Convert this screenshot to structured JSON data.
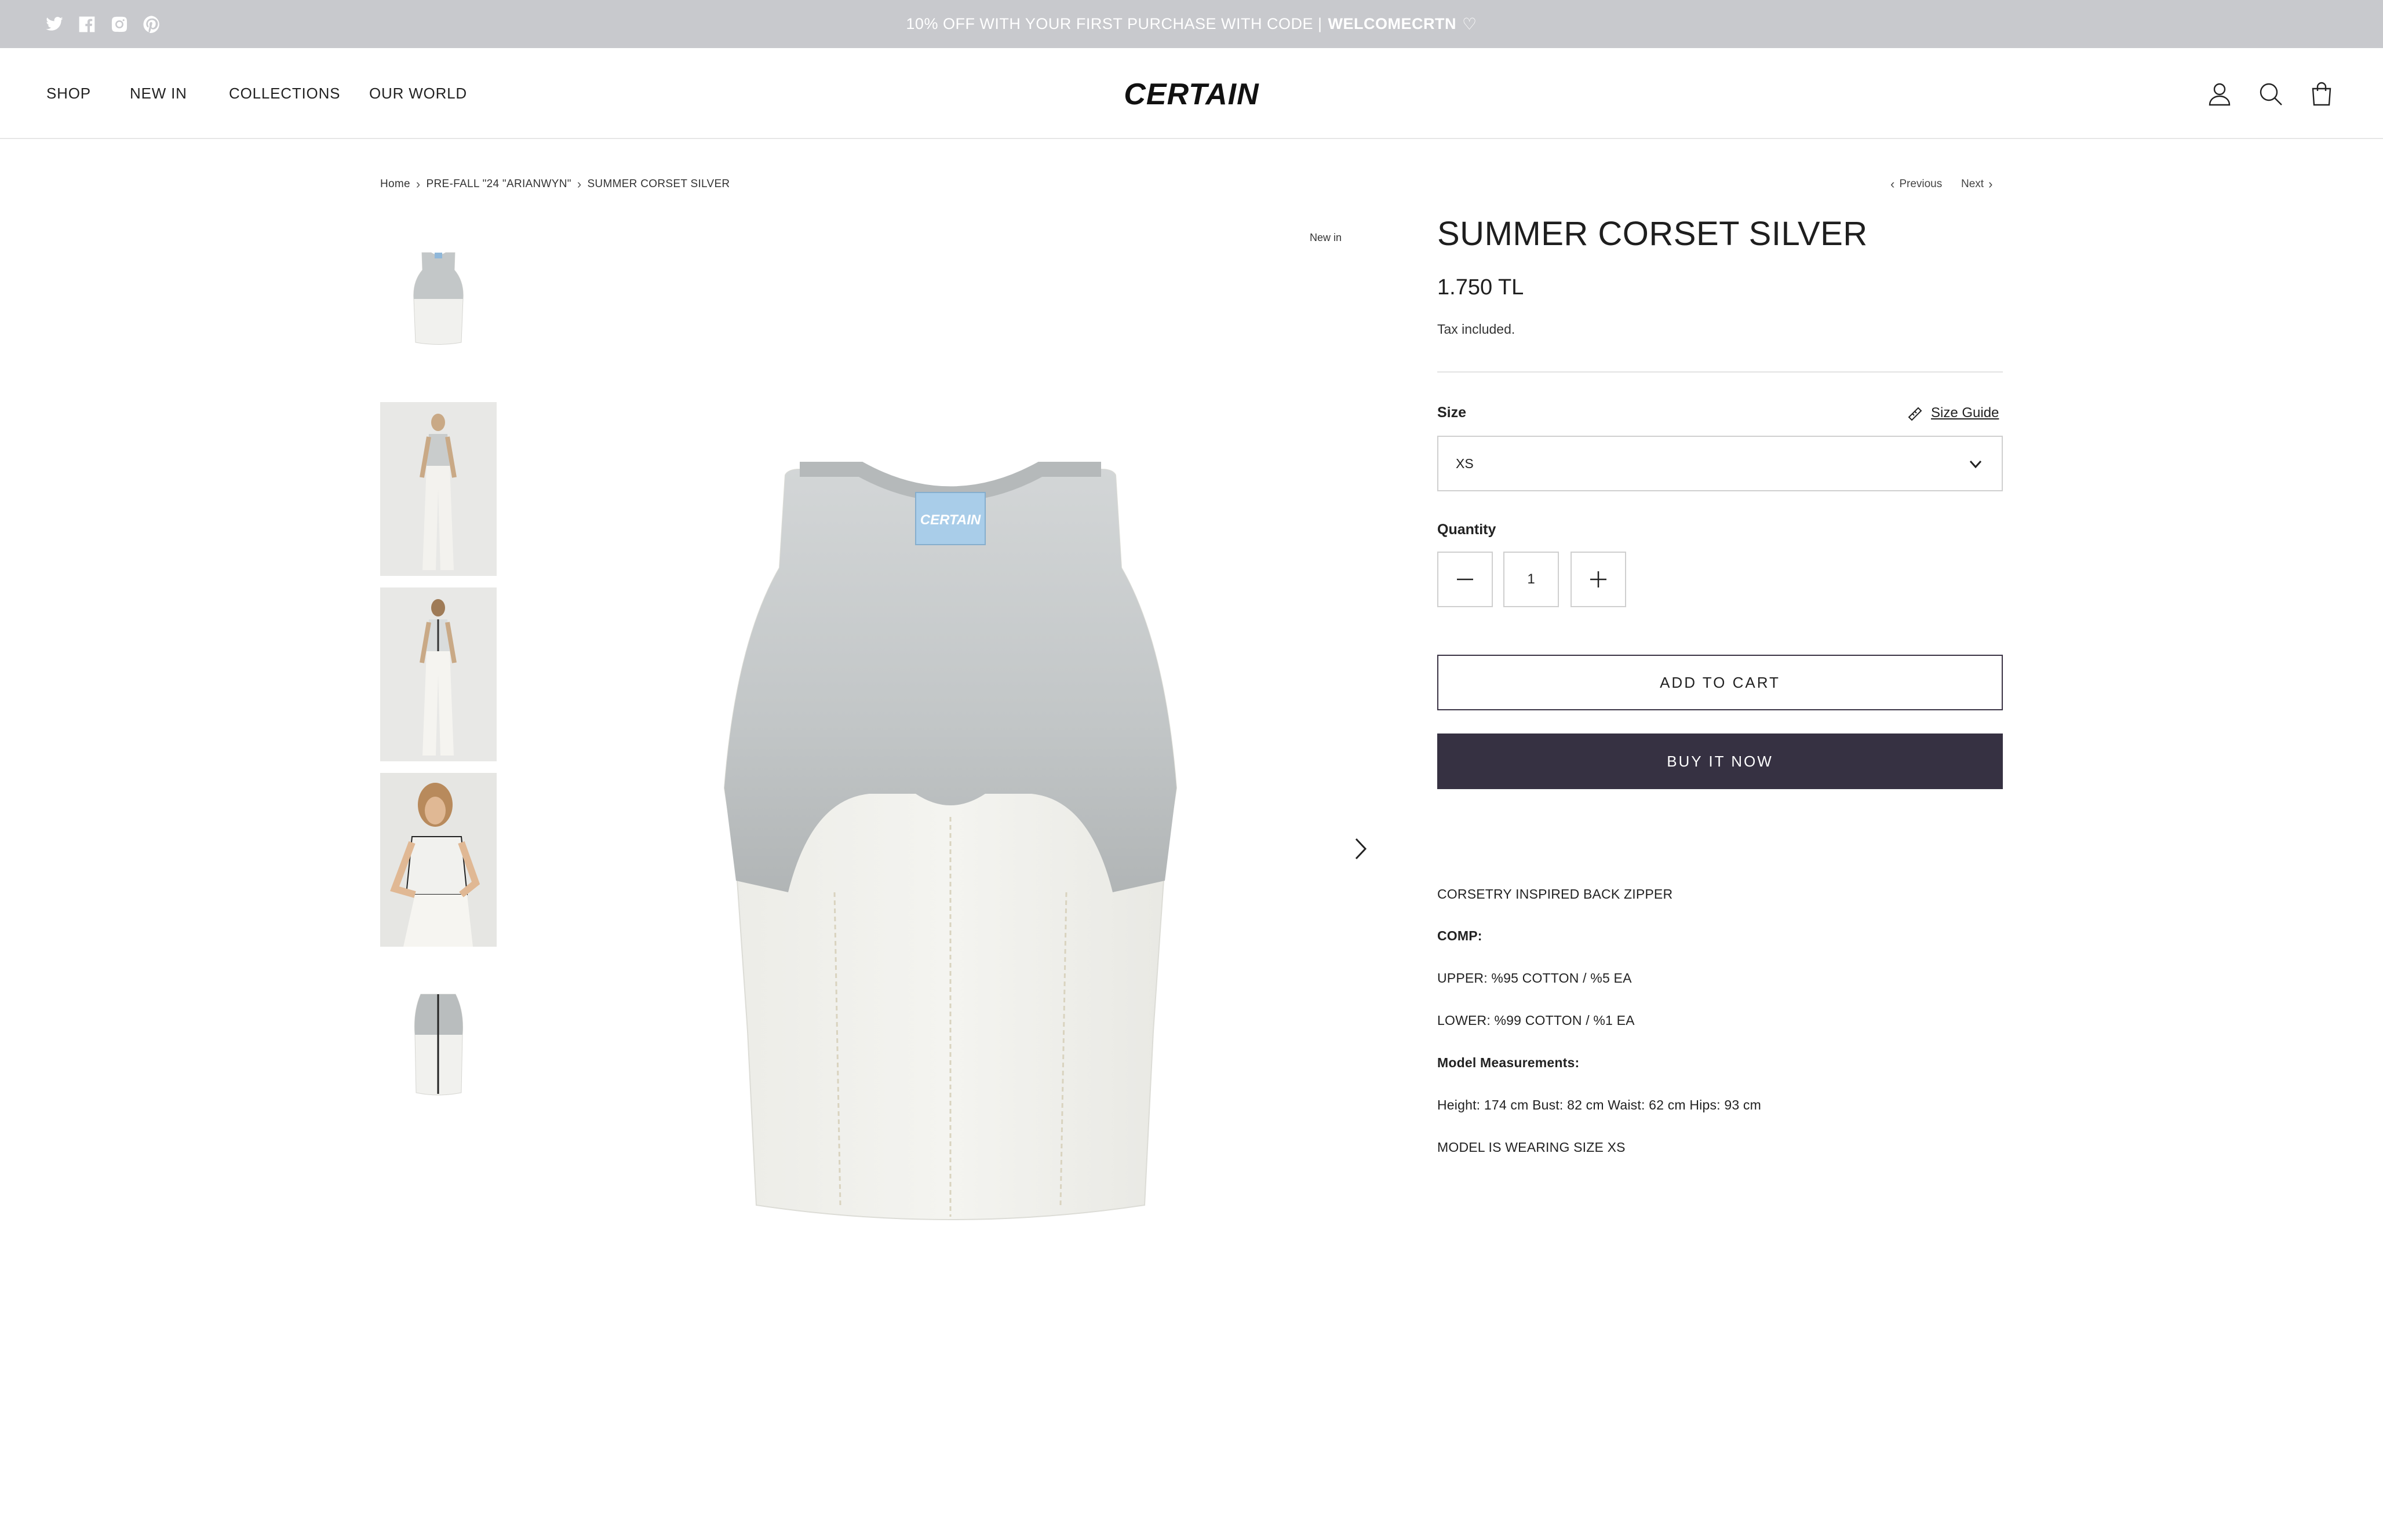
{
  "announcement": {
    "text": "10% OFF WITH YOUR FIRST PURCHASE WITH CODE |",
    "code": "WELCOMECRTN",
    "heart": "♡",
    "social_icons": [
      "twitter-icon",
      "facebook-icon",
      "instagram-icon",
      "pinterest-icon"
    ]
  },
  "header": {
    "logo": "CERTAIN",
    "nav": [
      "SHOP",
      "NEW IN",
      "COLLECTIONS",
      "OUR WORLD"
    ],
    "icons": [
      "account-icon",
      "search-icon",
      "cart-icon"
    ]
  },
  "breadcrumb": {
    "items": [
      "Home",
      "PRE-FALL \"24 \"ARIANWYN\"",
      "SUMMER CORSET SILVER"
    ],
    "previous": "Previous",
    "next": "Next"
  },
  "gallery": {
    "badge": "New in",
    "thumbnails": [
      "product-front",
      "model-front",
      "model-back",
      "model-detail",
      "product-back"
    ]
  },
  "product": {
    "title": "SUMMER CORSET SILVER",
    "price": "1.750 TL",
    "tax_note": "Tax included.",
    "size_label": "Size",
    "size_guide": "Size Guide",
    "size_selected": "XS",
    "quantity_label": "Quantity",
    "quantity": "1",
    "add_to_cart": "ADD TO CART",
    "buy_now": "BUY IT NOW"
  },
  "description": {
    "line1": "CORSETRY INSPIRED BACK ZIPPER",
    "comp_heading": "COMP:",
    "upper": "UPPER: %95 COTTON / %5 EA",
    "lower": "LOWER: %99 COTTON / %1 EA",
    "model_heading": "Model Measurements:",
    "measurements": "Height: 174 cm Bust: 82 cm Waist: 62 cm Hips: 93 cm",
    "model_size": "MODEL IS WEARING SIZE XS"
  },
  "colors": {
    "announcement_bg": "#c8c9cd",
    "buy_now_bg": "#363142"
  }
}
